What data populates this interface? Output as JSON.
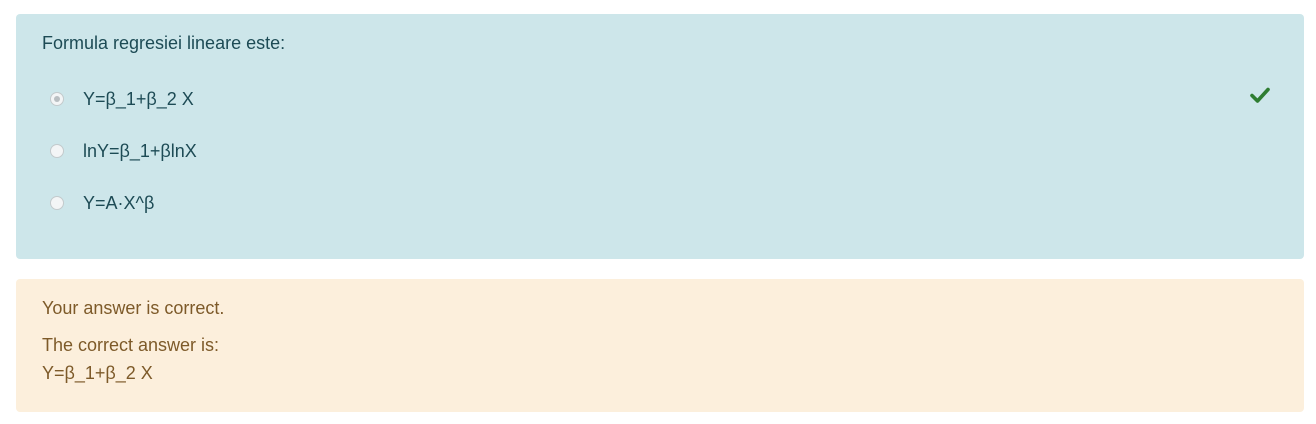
{
  "question": {
    "text": "Formula regresiei lineare este:",
    "options": [
      {
        "label": "Y=β_1+β_2 X",
        "selected": true
      },
      {
        "label": "lnY=β_1+βlnX",
        "selected": false
      },
      {
        "label": "Y=A·X^β",
        "selected": false
      }
    ],
    "status_icon": "check-icon",
    "colors": {
      "question_bg": "#cde6ea",
      "correct_mark": "#2e7d32"
    }
  },
  "feedback": {
    "result_text": "Your answer is correct.",
    "correct_answer_heading": "The correct answer is:",
    "correct_answer_value": "Y=β_1+β_2 X",
    "colors": {
      "feedback_bg": "#fcefdc",
      "feedback_text": "#7d5a29"
    }
  }
}
